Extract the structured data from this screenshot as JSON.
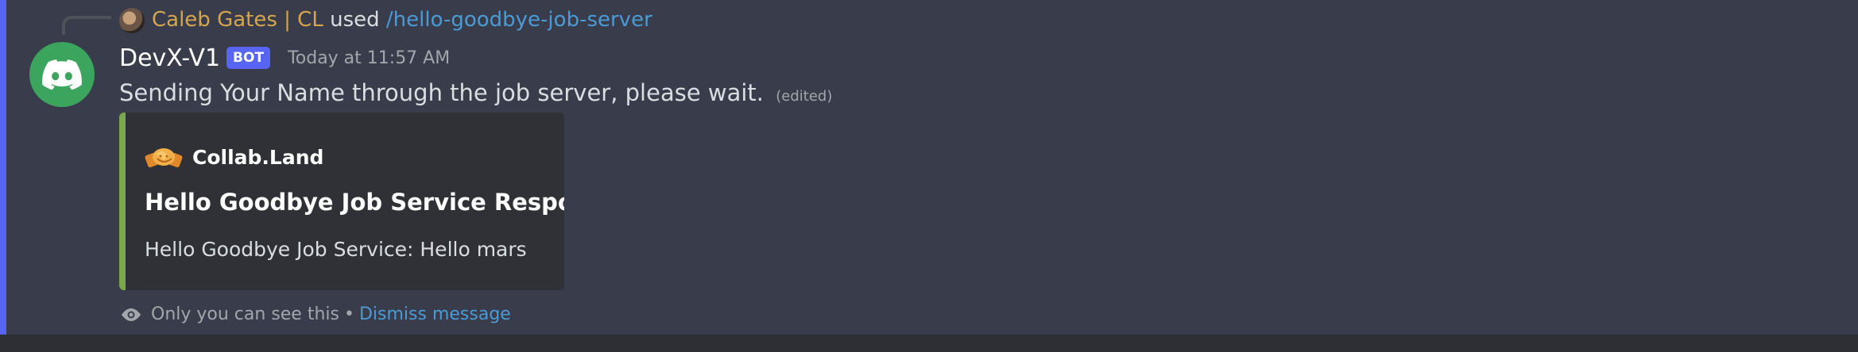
{
  "reply": {
    "username": "Caleb Gates | CL",
    "used_text": "used",
    "command": "/hello-goodbye-job-server"
  },
  "message": {
    "author": "DevX-V1",
    "bot_tag": "BOT",
    "timestamp": "Today at 11:57 AM",
    "content": "Sending Your Name through the job server, please wait.",
    "edited": "(edited)"
  },
  "embed": {
    "author_name": "Collab.Land",
    "title": "Hello Goodbye Job Service Response",
    "description": "Hello Goodbye Job Service: Hello mars",
    "color": "#7aa84b"
  },
  "ephemeral": {
    "text": "Only you can see this",
    "separator": "•",
    "dismiss_label": "Dismiss message"
  },
  "colors": {
    "accent": "#5865f2",
    "avatar_bg": "#3ba55d",
    "link": "#4a9bd5",
    "reply_username": "#d6a64e"
  }
}
